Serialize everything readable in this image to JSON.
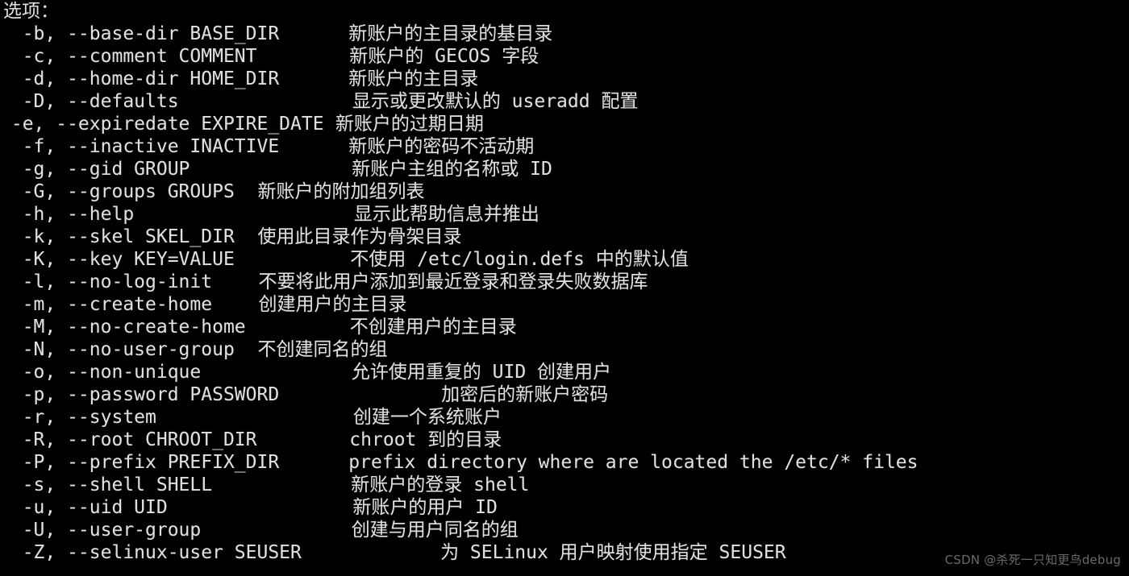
{
  "terminal": {
    "background_color": "#000000",
    "text_color": "#e0e0e0",
    "header": "选项：",
    "lines": [
      {
        "option": "  -b, --base-dir BASE_DIR",
        "desc_col": 31,
        "desc": "新账户的主目录的基目录"
      },
      {
        "option": "  -c, --comment COMMENT",
        "desc_col": 31,
        "desc": "新账户的 GECOS 字段"
      },
      {
        "option": "  -d, --home-dir HOME_DIR",
        "desc_col": 31,
        "desc": "新账户的主目录"
      },
      {
        "option": "  -D, --defaults",
        "desc_col": 31,
        "desc": "显示或更改默认的 useradd 配置"
      },
      {
        "option": " -e, --expiredate EXPIRE_DATE",
        "desc_col": 30,
        "desc": "新账户的过期日期"
      },
      {
        "option": "  -f, --inactive INACTIVE",
        "desc_col": 31,
        "desc": "新账户的密码不活动期"
      },
      {
        "option": "  -g, --gid GROUP",
        "desc_col": 31,
        "desc": "新账户主组的名称或 ID"
      },
      {
        "option": "  -G, --groups GROUPS",
        "desc_col": 23,
        "desc": "新账户的附加组列表"
      },
      {
        "option": "  -h, --help",
        "desc_col": 31,
        "desc": "显示此帮助信息并推出"
      },
      {
        "option": "  -k, --skel SKEL_DIR",
        "desc_col": 23,
        "desc": "使用此目录作为骨架目录"
      },
      {
        "option": "  -K, --key KEY=VALUE",
        "desc_col": 31,
        "desc": "不使用 /etc/login.defs 中的默认值"
      },
      {
        "option": "  -l, --no-log-init",
        "desc_col": 23,
        "desc": "不要将此用户添加到最近登录和登录失败数据库"
      },
      {
        "option": "  -m, --create-home",
        "desc_col": 23,
        "desc": "创建用户的主目录"
      },
      {
        "option": "  -M, --no-create-home",
        "desc_col": 31,
        "desc": "不创建用户的主目录"
      },
      {
        "option": "  -N, --no-user-group",
        "desc_col": 23,
        "desc": "不创建同名的组"
      },
      {
        "option": "  -o, --non-unique",
        "desc_col": 31,
        "desc": "允许使用重复的 UID 创建用户"
      },
      {
        "option": "  -p, --password PASSWORD",
        "desc_col": 39,
        "desc": "加密后的新账户密码"
      },
      {
        "option": "  -r, --system",
        "desc_col": 31,
        "desc": "创建一个系统账户"
      },
      {
        "option": "  -R, --root CHROOT_DIR",
        "desc_col": 31,
        "desc": "chroot 到的目录"
      },
      {
        "option": "  -P, --prefix PREFIX_DIR",
        "desc_col": 31,
        "desc": "prefix directory where are located the /etc/* files"
      },
      {
        "option": "  -s, --shell SHELL",
        "desc_col": 31,
        "desc": "新账户的登录 shell"
      },
      {
        "option": "  -u, --uid UID",
        "desc_col": 31,
        "desc": "新账户的用户 ID"
      },
      {
        "option": "  -U, --user-group",
        "desc_col": 31,
        "desc": "创建与用户同名的组"
      },
      {
        "option": "  -Z, --selinux-user SEUSER",
        "desc_col": 39,
        "desc": "为 SELinux 用户映射使用指定 SEUSER"
      }
    ]
  },
  "watermark": {
    "text": "CSDN @杀死一只知更鸟debug",
    "color": "#6a6a6a"
  }
}
